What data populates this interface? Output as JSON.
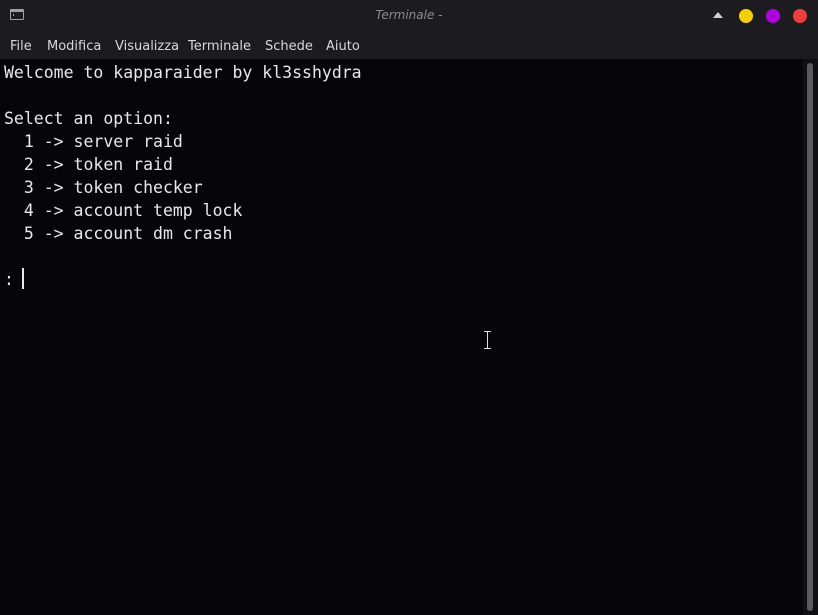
{
  "window": {
    "title": "Terminale -",
    "button_colors": {
      "minimize": "#f5d000",
      "maximize": "#b000e0",
      "close": "#f03c3c"
    }
  },
  "menubar": {
    "items": [
      "File",
      "Modifica",
      "Visualizza",
      "Terminale",
      "Schede",
      "Aiuto"
    ]
  },
  "terminal": {
    "lines": [
      "Welcome to kapparaider by kl3sshydra",
      "",
      "Select an option:",
      "  1 -> server raid",
      "  2 -> token raid",
      "  3 -> token checker",
      "  4 -> account temp lock",
      "  5 -> account dm crash",
      "",
      ": "
    ],
    "background": "#060609",
    "foreground": "#e8e8e8"
  },
  "icons": {
    "app": "terminal-icon",
    "shade": "shade-up-icon",
    "cursor": "i-beam-icon"
  }
}
